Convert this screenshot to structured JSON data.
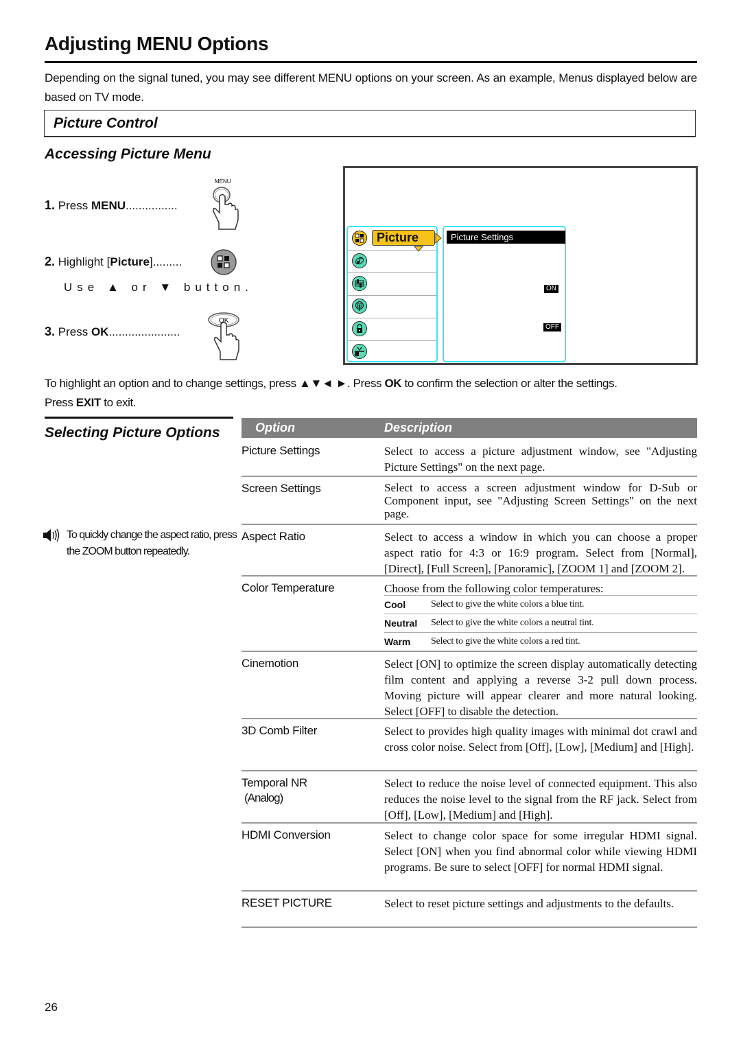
{
  "page": {
    "title": "Adjusting MENU Options",
    "intro": "Depending on the signal tuned, you may see different MENU options on your screen. As an example, Menus displayed below are based on TV mode.",
    "section_title": "Picture Control",
    "subsection_title": "Accessing Picture Menu",
    "page_number": "26"
  },
  "steps": [
    {
      "num": "1.",
      "prefix": "Press ",
      "key": "MENU",
      "dots": "................",
      "button_label": "MENU",
      "icon": "hand-press-menu-icon"
    },
    {
      "num": "2.",
      "prefix": "Highlight [",
      "key": "Picture",
      "suffix": "]",
      "dots": ".........",
      "hint": "Use ▲ or ▼ button.",
      "icon": "picture-menu-icon"
    },
    {
      "num": "3.",
      "prefix": "Press ",
      "key": "OK",
      "dots": "......................",
      "button_label": "OK",
      "icon": "hand-press-ok-icon"
    }
  ],
  "osd": {
    "menu_items": [
      {
        "name": "picture",
        "label": "Picture",
        "icon": "picture-grid-icon",
        "selected": true
      },
      {
        "name": "audio",
        "label": "",
        "icon": "music-note-icon"
      },
      {
        "name": "setup",
        "label": "",
        "icon": "sliders-icon"
      },
      {
        "name": "channel",
        "label": "",
        "icon": "antenna-icon"
      },
      {
        "name": "lock",
        "label": "",
        "icon": "lock-icon"
      },
      {
        "name": "input",
        "label": "",
        "icon": "tv-input-icon"
      }
    ],
    "submenu_highlight": "Picture Settings",
    "toggle_on": "ON",
    "toggle_off": "OFF",
    "colors": {
      "frame": "#3de6f2",
      "selected": "#f7c21a",
      "icon_fill": "#5ad9b5"
    }
  },
  "navigation": {
    "part1": "To highlight an option and to change settings, press ▲▼◄ ►. Press ",
    "ok": "OK",
    "part2": " to confirm the selection or alter the settings.",
    "part3": "Press ",
    "exit": "EXIT",
    "part4": " to exit."
  },
  "selecting": {
    "title": "Selecting Picture Options",
    "tip": "To quickly change the aspect ratio, press the ZOOM button repeatedly.",
    "tip_icon": "speaker-icon"
  },
  "table": {
    "headers": {
      "option": "Option",
      "description": "Description"
    },
    "rows": [
      {
        "option": "Picture Settings",
        "description": "Select to access a picture adjustment window, see \"Adjusting Picture Settings\" on the next page."
      },
      {
        "option": "Screen Settings",
        "description": "Select to access a screen adjustment window for D-Sub or Component input, see \"Adjusting Screen Settings\" on the next page."
      },
      {
        "option": "Aspect Ratio",
        "description": "Select to access a window in which you can choose a proper aspect ratio for 4:3 or 16:9 program. Select from [Normal], [Direct], [Full Screen], [Panoramic], [ZOOM 1] and [ZOOM 2]."
      },
      {
        "option": "Color Temperature",
        "description": "Choose from the following color temperatures:",
        "sub": [
          {
            "key": "Cool",
            "value": "Select to give the white colors a blue tint."
          },
          {
            "key": "Neutral",
            "value": "Select to give the white colors a neutral tint."
          },
          {
            "key": "Warm",
            "value": "Select to give the white colors a red tint."
          }
        ]
      },
      {
        "option": "Cinemotion",
        "description": "Select [ON] to optimize the screen display automatically detecting film content and applying a reverse 3-2 pull down process. Moving picture will appear clearer and more natural looking. Select [OFF] to disable the detection."
      },
      {
        "option": "3D Comb Filter",
        "description": "Select to provides high quality images with minimal dot crawl and cross color noise. Select from [Off], [Low], [Medium] and [High]."
      },
      {
        "option": "Temporal NR\n (Analog)",
        "option_line1": "Temporal NR",
        "option_line2": "(Analog)",
        "description": "Select to reduce the noise level of connected equipment. This also reduces the noise level to the signal from the RF jack. Select from [Off], [Low], [Medium] and [High]."
      },
      {
        "option": "HDMI Conversion",
        "description": "Select to change color space for some irregular HDMI signal. Select [ON] when you find abnormal color while viewing HDMI programs. Be sure to select [OFF] for normal HDMI signal."
      },
      {
        "option": "RESET PICTURE",
        "description": "Select to reset picture settings and adjustments to the defaults."
      }
    ]
  }
}
